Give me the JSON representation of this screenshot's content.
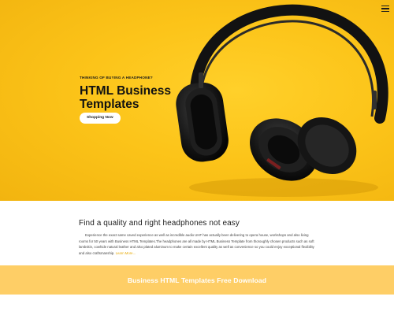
{
  "header": {
    "menu_icon": "hamburger-menu-icon"
  },
  "hero": {
    "eyebrow": "THINKING OF BUYING A HEADPHONE?",
    "title": "HTML Business Templates",
    "cta_label": "Shopping Now",
    "image_subject": "black-headphones"
  },
  "section": {
    "heading": "Find a quality and right headphones not easy",
    "body": "Experience the exact same caved experience as well as incredible audio UHF has actually been delivering to opera house, workshops and also living rooms for 50 years with Business HTML Templates.The headphones are all made by HTML Business Template from thoroughly chosen products such as soft lambskin, cowhide natural leather and also plated aluminum to make certain excellent quality as well as convenience so you could enjoy exceptional flexibility and also craftsmanship.",
    "learn_more": "Learn More..."
  },
  "download_band": {
    "label": "Business HTML Templates Free Download"
  },
  "colors": {
    "hero_bg": "#fcc419",
    "band_bg": "#fece66",
    "link": "#e6a800",
    "text_dark": "#111111"
  }
}
